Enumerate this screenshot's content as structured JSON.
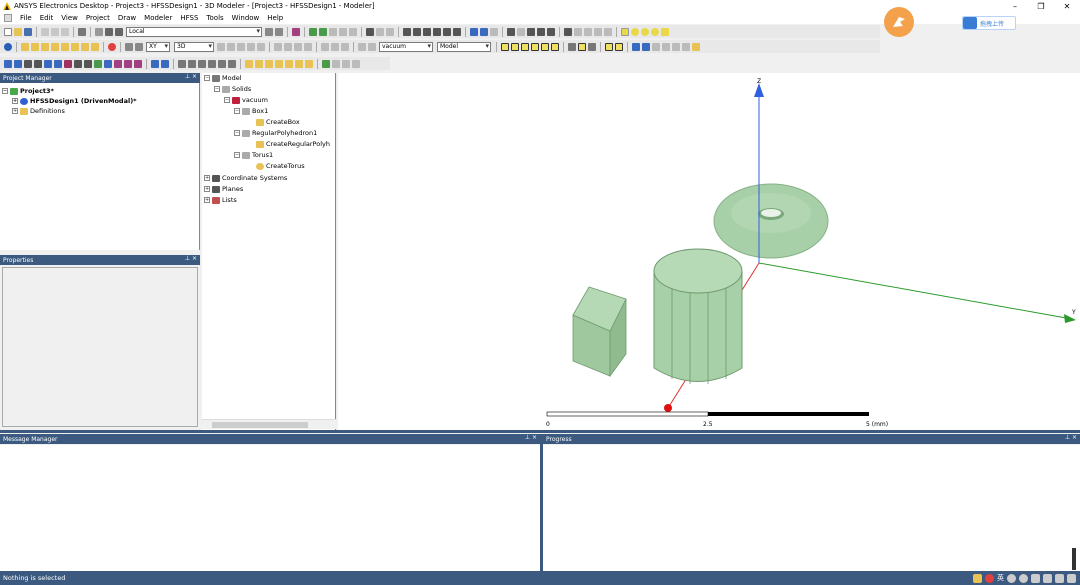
{
  "window": {
    "title": "ANSYS Electronics Desktop - Project3 - HFSSDesign1 - 3D Modeler - [Project3 - HFSSDesign1 - Modeler]",
    "buttons": [
      "–",
      "❐",
      "✕"
    ]
  },
  "menu": [
    "File",
    "Edit",
    "View",
    "Project",
    "Draw",
    "Modeler",
    "HFSS",
    "Tools",
    "Window",
    "Help"
  ],
  "toolbar": {
    "coord_system": "Local",
    "plane": "XY",
    "dimension": "3D",
    "material": "vacuum",
    "mode": "Model"
  },
  "upload_button": {
    "label": "拖拽上传"
  },
  "project_manager": {
    "title": "Project Manager",
    "items": [
      {
        "label": "Project3*",
        "level": 0
      },
      {
        "label": "HFSSDesign1 (DrivenModal)*",
        "level": 1
      },
      {
        "label": "Definitions",
        "level": 1
      }
    ]
  },
  "properties": {
    "title": "Properties"
  },
  "model_tree": {
    "items": [
      {
        "label": "Model",
        "level": 0
      },
      {
        "label": "Solids",
        "level": 1
      },
      {
        "label": "vacuum",
        "level": 2
      },
      {
        "label": "Box1",
        "level": 3
      },
      {
        "label": "CreateBox",
        "level": 4
      },
      {
        "label": "RegularPolyhedron1",
        "level": 3
      },
      {
        "label": "CreateRegularPolyh",
        "level": 4
      },
      {
        "label": "Torus1",
        "level": 3
      },
      {
        "label": "CreateTorus",
        "level": 4
      },
      {
        "label": "Coordinate Systems",
        "level": 0
      },
      {
        "label": "Planes",
        "level": 0
      },
      {
        "label": "Lists",
        "level": 0
      }
    ]
  },
  "viewport": {
    "axis_z_label": "Z",
    "axis_y_label": "Y",
    "scale_labels": [
      "0",
      "2.5",
      "5 (mm)"
    ],
    "colors": {
      "solid_fill": "#a8d0a8",
      "solid_stroke": "#6f9a6f",
      "axis_x": "#e03030",
      "axis_y": "#2a9a2a",
      "axis_z": "#3060e0"
    }
  },
  "message_manager": {
    "title": "Message Manager"
  },
  "progress": {
    "title": "Progress"
  },
  "status": {
    "text": "Nothing is selected"
  },
  "tray": {
    "ime_label": "英"
  }
}
